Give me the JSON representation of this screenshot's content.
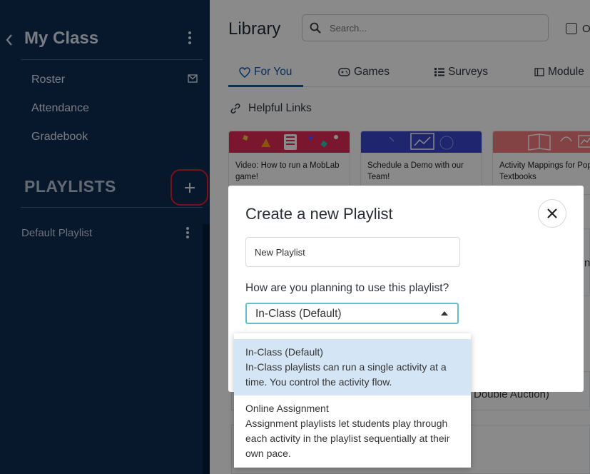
{
  "sidebar": {
    "title": "My Class",
    "nav_items": [
      "Roster",
      "Attendance",
      "Gradebook"
    ],
    "playlists_heading": "PLAYLISTS",
    "playlist_items": [
      "Default Playlist"
    ],
    "colors": {
      "background": "#0d2b52",
      "highlight": "#e21f2d"
    }
  },
  "main": {
    "title": "Library",
    "search": {
      "placeholder": "Search..."
    },
    "top_checkbox_label": "O",
    "tabs": [
      {
        "label": "For You",
        "active": true
      },
      {
        "label": "Games"
      },
      {
        "label": "Surveys"
      },
      {
        "label": "Module"
      }
    ],
    "helpful_links_label": "Helpful Links",
    "cards": [
      {
        "caption": "Video: How to run a MobLab game!"
      },
      {
        "caption": "Schedule a Demo with our Team!"
      },
      {
        "caption": "Activity Mappings for Popular Textbooks"
      }
    ],
    "background_fragments": [
      "Double Auction)",
      "ne"
    ]
  },
  "modal": {
    "title": "Create a new Playlist",
    "name_input_value": "New Playlist",
    "usage_question": "How are you planning to use this playlist?",
    "selected_option": "In-Class (Default)",
    "options": [
      {
        "title": "In-Class (Default)",
        "description": "In-Class playlists can run a single activity at a time. You control the activity flow."
      },
      {
        "title": "Online Assignment",
        "description": "Assignment playlists let students play through each activity in the playlist sequentially at their own pace."
      }
    ]
  }
}
